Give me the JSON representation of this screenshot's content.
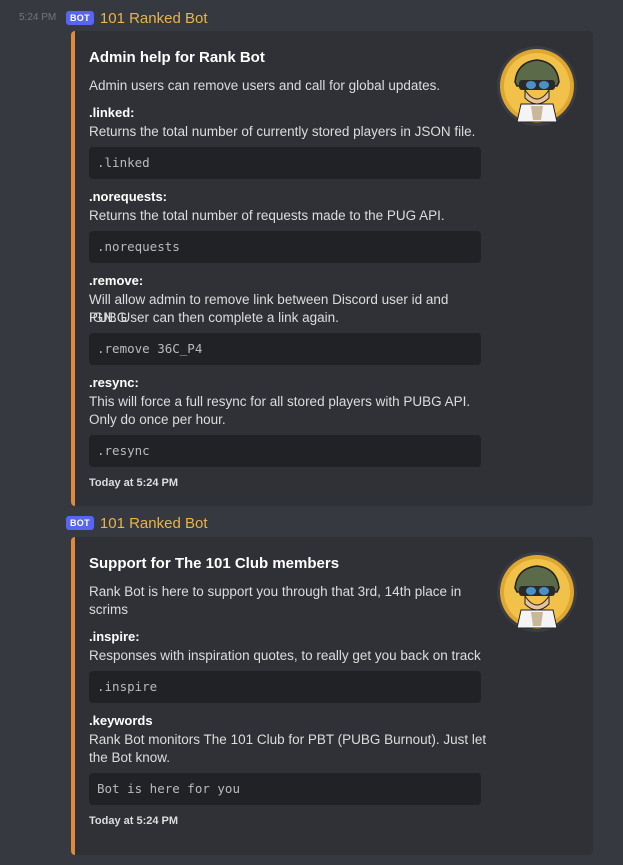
{
  "message1": {
    "timestamp": "5:24 PM",
    "bot_tag": "BOT",
    "username": "101 Ranked Bot",
    "embed": {
      "title": "Admin help for Rank Bot",
      "description": "Admin users can remove users and call for global updates.",
      "fields": [
        {
          "name": ".linked:",
          "value_line1": "Returns the total number of currently stored players in JSON file.",
          "value_line2": "",
          "code": ".linked"
        },
        {
          "name": ".norequests:",
          "value_line1": "Returns the total number of requests made to the PUG API.",
          "value_line2": "",
          "code": ".norequests"
        },
        {
          "name": ".remove:",
          "value_line1": "Will allow admin to remove link between Discord user id and PUBG",
          "value_line2": "IGN. User can then complete a link again.",
          "code": ".remove 36C_P4"
        },
        {
          "name": ".resync:",
          "value_line1": "This will force a full resync for all stored players with PUBG API.",
          "value_line2": "Only do once per hour.",
          "code": ".resync"
        }
      ],
      "footer": "Today at 5:24 PM",
      "accent_color": "#e08a3c"
    }
  },
  "message2": {
    "bot_tag": "BOT",
    "username": "101 Ranked Bot",
    "embed": {
      "title": "Support for The 101 Club members",
      "description_line1": "Rank Bot is here to support you through that 3rd, 14th place in",
      "description_line2": "scrims",
      "fields": [
        {
          "name": ".inspire:",
          "value_line1": "Responses with inspiration quotes, to really get you back on track",
          "value_line2": "",
          "code": ".inspire"
        },
        {
          "name": ".keywords",
          "value_line1": "Rank Bot monitors The 101 Club for PBT (PUBG Burnout). Just let",
          "value_line2": "the Bot know.",
          "code": "Bot is here for you"
        }
      ],
      "footer": "Today at 5:24 PM",
      "accent_color": "#e08a3c"
    }
  },
  "icons": {
    "thumbnail": "pubg-helmet-avatar-icon"
  }
}
